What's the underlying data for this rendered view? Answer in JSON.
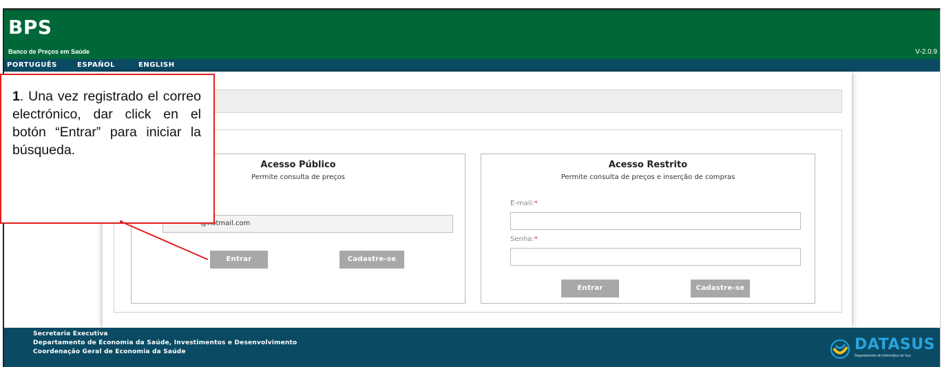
{
  "header": {
    "brand": "BPS",
    "brand_subtitle": "Banco de Preços em Saúde",
    "version": "V-2.0.9",
    "bg_color": "#006838"
  },
  "languages": [
    "PORTUGUÊS",
    "ESPAÑOL",
    "ENGLISH"
  ],
  "public_access": {
    "title": "Acesso Público",
    "subtitle": "Permite consulta de preços",
    "email_value": "@hotmail.com",
    "enter_label": "Entrar",
    "register_label": "Cadastre-se"
  },
  "restricted_access": {
    "title": "Acesso Restrito",
    "subtitle": "Permite consulta de preços e inserção de compras",
    "email_label": "E-mail:",
    "password_label": "Senha:",
    "required_mark": "*",
    "enter_label": "Entrar",
    "register_label": "Cadastre-se"
  },
  "footer": {
    "line1": "Secretaria Executiva",
    "line2": "Departamento de Economia da Saúde, Investimentos e Desenvolvimento",
    "line3": "Coordenação Geral de Economia da Saúde",
    "logo_text": "DATASUS",
    "logo_subtitle": "Departamento de Informática do Sus"
  },
  "callout": {
    "number": "1",
    "text": ". Una vez registrado el correo electrónico, dar click en el botón “Entrar” para iniciar la búsqueda.",
    "border_color": "#e11d1d"
  }
}
